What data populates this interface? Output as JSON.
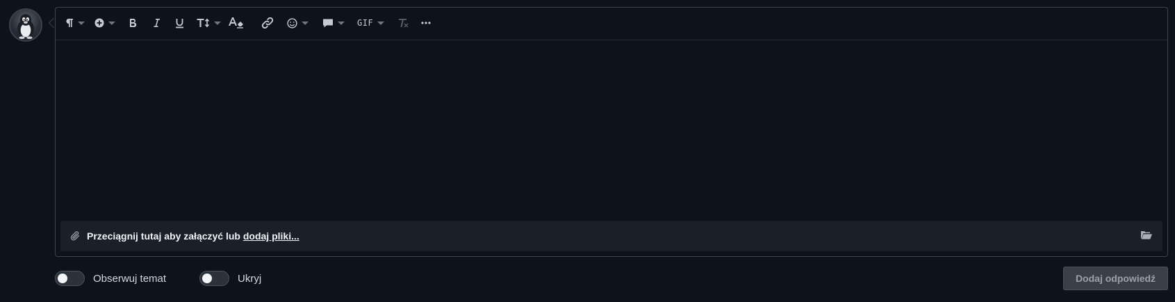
{
  "avatar": {
    "icon": "tux-penguin-avatar"
  },
  "toolbar": {
    "items": [
      {
        "name": "paragraph-format",
        "icon": "pilcrow-icon",
        "dropdown": true
      },
      {
        "name": "insert",
        "icon": "plus-circle-icon",
        "dropdown": true
      },
      {
        "name": "bold",
        "icon": "bold-icon",
        "label": "B"
      },
      {
        "name": "italic",
        "icon": "italic-icon",
        "label": "I"
      },
      {
        "name": "underline",
        "icon": "underline-icon",
        "label": "U"
      },
      {
        "name": "text-size",
        "icon": "text-size-icon",
        "dropdown": true
      },
      {
        "name": "text-color",
        "icon": "text-color-icon"
      },
      {
        "name": "link",
        "icon": "link-icon"
      },
      {
        "name": "emoji",
        "icon": "smile-icon",
        "dropdown": true
      },
      {
        "name": "quote",
        "icon": "comment-icon",
        "dropdown": true
      },
      {
        "name": "gif",
        "label": "GIF",
        "dropdown": true
      },
      {
        "name": "clear-format",
        "icon": "clear-format-icon",
        "disabled": true
      },
      {
        "name": "more",
        "icon": "ellipsis-icon"
      }
    ],
    "gif_label": "GIF"
  },
  "attachments": {
    "prompt": "Przeciągnij tutaj aby załączyć lub ",
    "link": "dodaj pliki..."
  },
  "options": {
    "watch_label": "Obserwuj temat",
    "hide_label": "Ukryj",
    "watch_on": false,
    "hide_on": false
  },
  "submit": {
    "label": "Dodaj odpowiedź"
  },
  "colors": {
    "background": "#0d131b",
    "border": "#3c4450",
    "attach_bg": "#1a2029",
    "button_bg": "#3a4048"
  }
}
